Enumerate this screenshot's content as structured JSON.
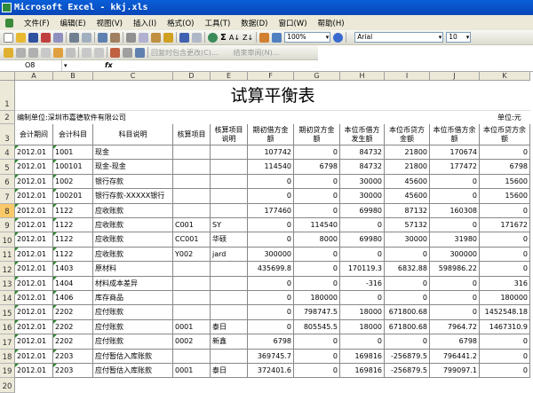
{
  "window": {
    "title": "Microsoft Excel - kkj.xls"
  },
  "menu": [
    "文件(F)",
    "编辑(E)",
    "视图(V)",
    "插入(I)",
    "格式(O)",
    "工具(T)",
    "数据(D)",
    "窗口(W)",
    "帮助(H)"
  ],
  "toolbar": {
    "zoom": "100%",
    "font": "Arial",
    "font_size": "10",
    "review_reply": "回复时包含更改(C)...",
    "review_end": "结束审阅(N)..."
  },
  "formula_bar": {
    "name_box": "O8",
    "fx": "fx",
    "value": ""
  },
  "columns": [
    "A",
    "B",
    "C",
    "D",
    "E",
    "F",
    "G",
    "H",
    "I",
    "J",
    "K"
  ],
  "selected_row": "8",
  "sheet": {
    "title": "试算平衡表",
    "company": "编制单位:深圳市嘉德软件有限公司",
    "unit": "单位:元",
    "headers": [
      "会计期间",
      "会计科目",
      "科目说明",
      "核算项目",
      "核算项目说明",
      "期初借方金额",
      "期初贷方金额",
      "本位币借方发生额",
      "本位币贷方金额",
      "本位币借方余额",
      "本位币贷方余额"
    ],
    "rows": [
      [
        "2012.01",
        "1001",
        "现金",
        "",
        "",
        "107742",
        "0",
        "84732",
        "21800",
        "170674",
        "0"
      ],
      [
        "2012.01",
        "100101",
        "现金-现金",
        "",
        "",
        "114540",
        "6798",
        "84732",
        "21800",
        "177472",
        "6798"
      ],
      [
        "2012.01",
        "1002",
        "银行存款",
        "",
        "",
        "0",
        "0",
        "30000",
        "45600",
        "0",
        "15600"
      ],
      [
        "2012.01",
        "100201",
        "银行存款-XXXXX银行",
        "",
        "",
        "0",
        "0",
        "30000",
        "45600",
        "0",
        "15600"
      ],
      [
        "2012.01",
        "1122",
        "应收账款",
        "",
        "",
        "177460",
        "0",
        "69980",
        "87132",
        "160308",
        "0"
      ],
      [
        "2012.01",
        "1122",
        "应收账款",
        "C001",
        "SY",
        "0",
        "114540",
        "0",
        "57132",
        "0",
        "171672"
      ],
      [
        "2012.01",
        "1122",
        "应收账款",
        "CC001",
        "华硕",
        "0",
        "8000",
        "69980",
        "30000",
        "31980",
        "0"
      ],
      [
        "2012.01",
        "1122",
        "应收账款",
        "Y002",
        "jard",
        "300000",
        "0",
        "0",
        "0",
        "300000",
        "0"
      ],
      [
        "2012.01",
        "1403",
        "原材料",
        "",
        "",
        "435699.8",
        "0",
        "170119.3",
        "6832.88",
        "598986.22",
        "0"
      ],
      [
        "2012.01",
        "1404",
        "材料成本差异",
        "",
        "",
        "0",
        "0",
        "-316",
        "0",
        "0",
        "316"
      ],
      [
        "2012.01",
        "1406",
        "库存商品",
        "",
        "",
        "0",
        "180000",
        "0",
        "0",
        "0",
        "180000"
      ],
      [
        "2012.01",
        "2202",
        "应付账款",
        "",
        "",
        "0",
        "798747.5",
        "18000",
        "671800.68",
        "0",
        "1452548.18"
      ],
      [
        "2012.01",
        "2202",
        "应付账款",
        "0001",
        "泰日",
        "0",
        "805545.5",
        "18000",
        "671800.68",
        "7964.72",
        "1467310.9"
      ],
      [
        "2012.01",
        "2202",
        "应付账款",
        "0002",
        "新鑫",
        "6798",
        "0",
        "0",
        "0",
        "6798",
        "0"
      ],
      [
        "2012.01",
        "2203",
        "应付暂估入库账款",
        "",
        "",
        "369745.7",
        "0",
        "169816",
        "-256879.5",
        "796441.2",
        "0"
      ],
      [
        "2012.01",
        "2203",
        "应付暂估入库账款",
        "0001",
        "泰日",
        "372401.6",
        "0",
        "169816",
        "-256879.5",
        "799097.1",
        "0"
      ]
    ]
  }
}
